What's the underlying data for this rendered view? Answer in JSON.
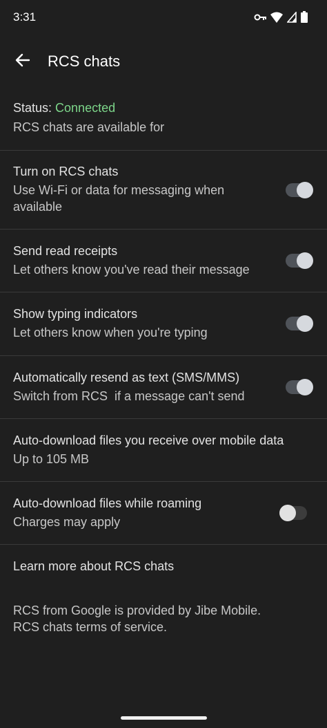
{
  "status_bar": {
    "time": "3:31",
    "icons": [
      "vpn-key-icon",
      "wifi-icon",
      "cell-signal-icon",
      "battery-icon"
    ]
  },
  "app_bar": {
    "title": "RCS chats",
    "back_icon": "arrow-back-icon"
  },
  "status": {
    "label": "Status: ",
    "value": "Connected",
    "value_color": "#7dd68a",
    "subtitle": "RCS chats are available for"
  },
  "settings": [
    {
      "title": "Turn on RCS chats",
      "subtitle": "Use Wi-Fi or data for messaging when available",
      "toggle": true
    },
    {
      "title": "Send read receipts",
      "subtitle": "Let others know you've read their message",
      "toggle": true
    },
    {
      "title": "Show typing indicators",
      "subtitle": "Let others know when you're typing",
      "toggle": true
    },
    {
      "title": "Automatically resend as text (SMS/MMS)",
      "subtitle": "Switch from RCS  if a message can't send",
      "toggle": true
    },
    {
      "title": "Auto-download files you receive over mobile data",
      "subtitle": "Up to 105 MB"
    },
    {
      "title": "Auto-download files while roaming",
      "subtitle": "Charges may apply",
      "toggle": false
    }
  ],
  "learn_more": "Learn more about RCS chats",
  "footer": {
    "line1": "RCS from Google is provided by Jibe Mobile.",
    "line2": "RCS chats terms of service."
  }
}
